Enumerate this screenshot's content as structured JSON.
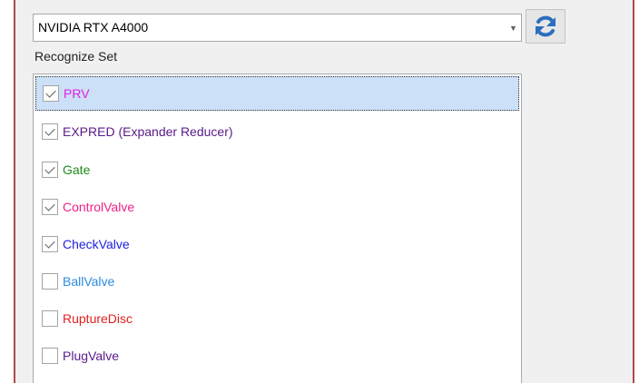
{
  "device_select": {
    "value": "NVIDIA RTX A4000",
    "arrow_icon": "chevron-down-icon"
  },
  "refresh_button": {
    "icon": "refresh-icon",
    "color": "#2a6ebd"
  },
  "recognize_set": {
    "label": "Recognize Set",
    "items": [
      {
        "label": "PRV",
        "checked": true,
        "color": "#e020e0",
        "selected": true
      },
      {
        "label": "EXPRED (Expander Reducer)",
        "checked": true,
        "color": "#5a1a8a",
        "selected": false
      },
      {
        "label": "Gate",
        "checked": true,
        "color": "#1e8c1e",
        "selected": false
      },
      {
        "label": "ControlValve",
        "checked": true,
        "color": "#ee2288",
        "selected": false
      },
      {
        "label": "CheckValve",
        "checked": true,
        "color": "#2020e0",
        "selected": false
      },
      {
        "label": "BallValve",
        "checked": false,
        "color": "#2a8ae0",
        "selected": false
      },
      {
        "label": "RuptureDisc",
        "checked": false,
        "color": "#e02020",
        "selected": false
      },
      {
        "label": "PlugValve",
        "checked": false,
        "color": "#5a1a8a",
        "selected": false
      }
    ]
  },
  "accent_colors": {
    "panel_border": "#b04a4a",
    "selection_background": "#cce0f7"
  }
}
